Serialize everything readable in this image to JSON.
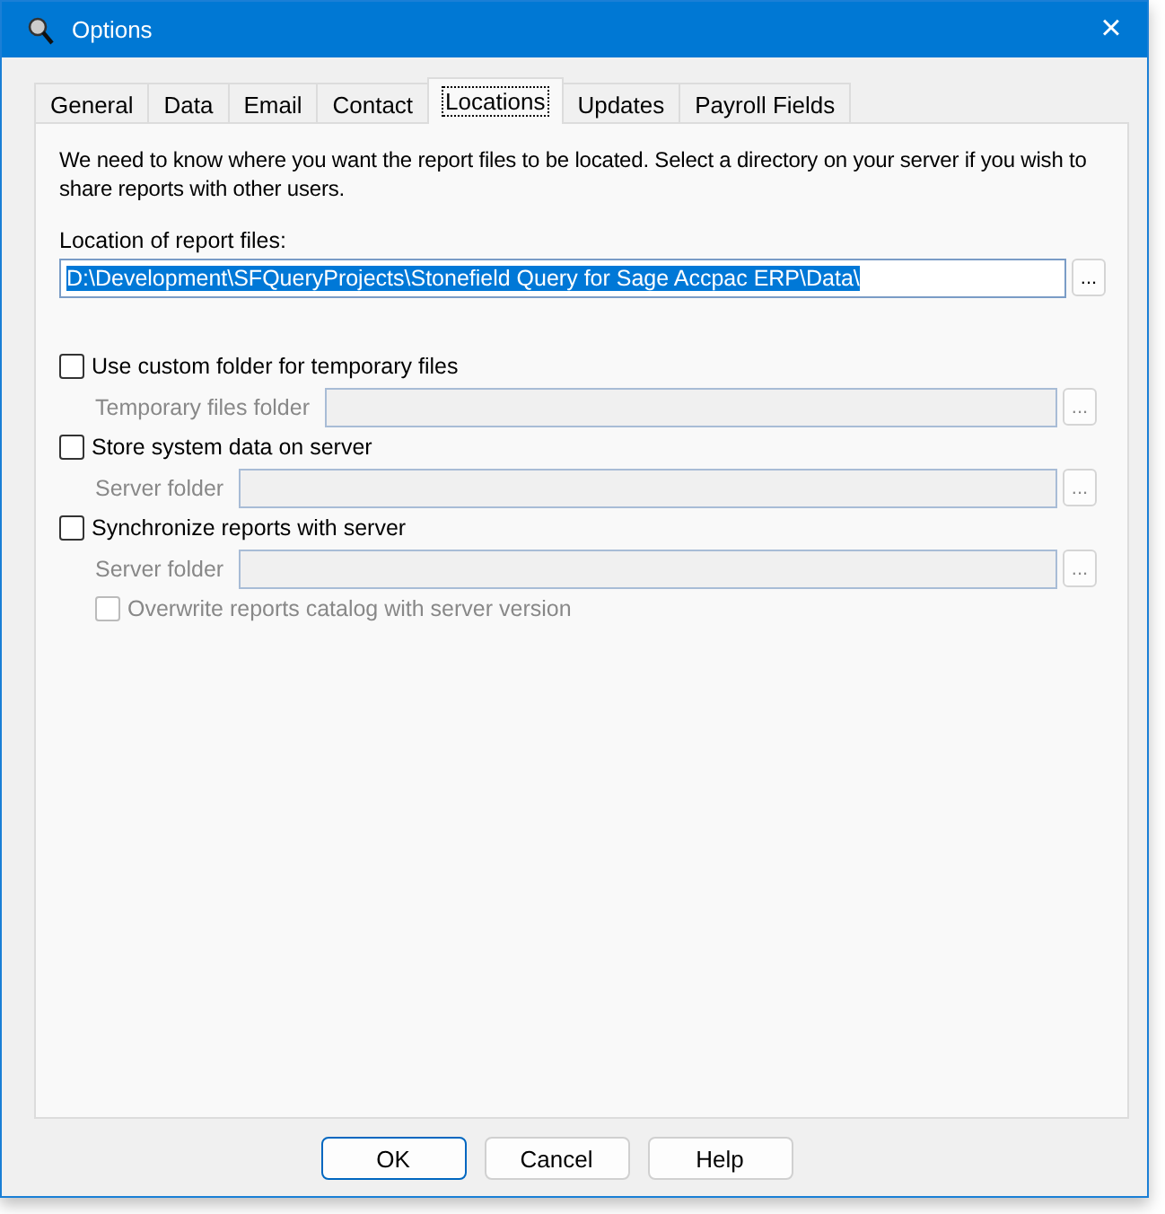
{
  "window": {
    "title": "Options",
    "close": "×"
  },
  "tabs": [
    {
      "label": "General",
      "selected": false
    },
    {
      "label": "Data",
      "selected": false
    },
    {
      "label": "Email",
      "selected": false
    },
    {
      "label": "Contact",
      "selected": false
    },
    {
      "label": "Locations",
      "selected": true
    },
    {
      "label": "Updates",
      "selected": false
    },
    {
      "label": "Payroll Fields",
      "selected": false
    }
  ],
  "intro": "We need to know where you want the report files to be located. Select a directory on your server if you wish to share reports with other users.",
  "location": {
    "label": "Location of report files:",
    "value": "D:\\Development\\SFQueryProjects\\Stonefield Query for Sage Accpac ERP\\Data\\",
    "text_selected": true,
    "browse": "..."
  },
  "settings": [
    {
      "kind": "checkbox",
      "label": "Use custom folder for temporary files",
      "checked": false,
      "disabled": false
    },
    {
      "kind": "folder",
      "label": "Temporary files folder",
      "browse": "...",
      "disabled": true
    },
    {
      "kind": "checkbox",
      "label": "Store system data on server",
      "checked": false,
      "disabled": false
    },
    {
      "kind": "folder",
      "label": "Server folder",
      "browse": "...",
      "disabled": true
    },
    {
      "kind": "checkbox",
      "label": "Synchronize reports with server",
      "checked": false,
      "disabled": false
    },
    {
      "kind": "folder",
      "label": "Server folder",
      "browse": "...",
      "disabled": true
    },
    {
      "kind": "subcheckbox",
      "label": "Overwrite reports catalog with server version",
      "checked": false,
      "disabled": true
    }
  ],
  "buttons": [
    {
      "label": "OK",
      "default": true
    },
    {
      "label": "Cancel",
      "default": false
    },
    {
      "label": "Help",
      "default": false
    }
  ]
}
